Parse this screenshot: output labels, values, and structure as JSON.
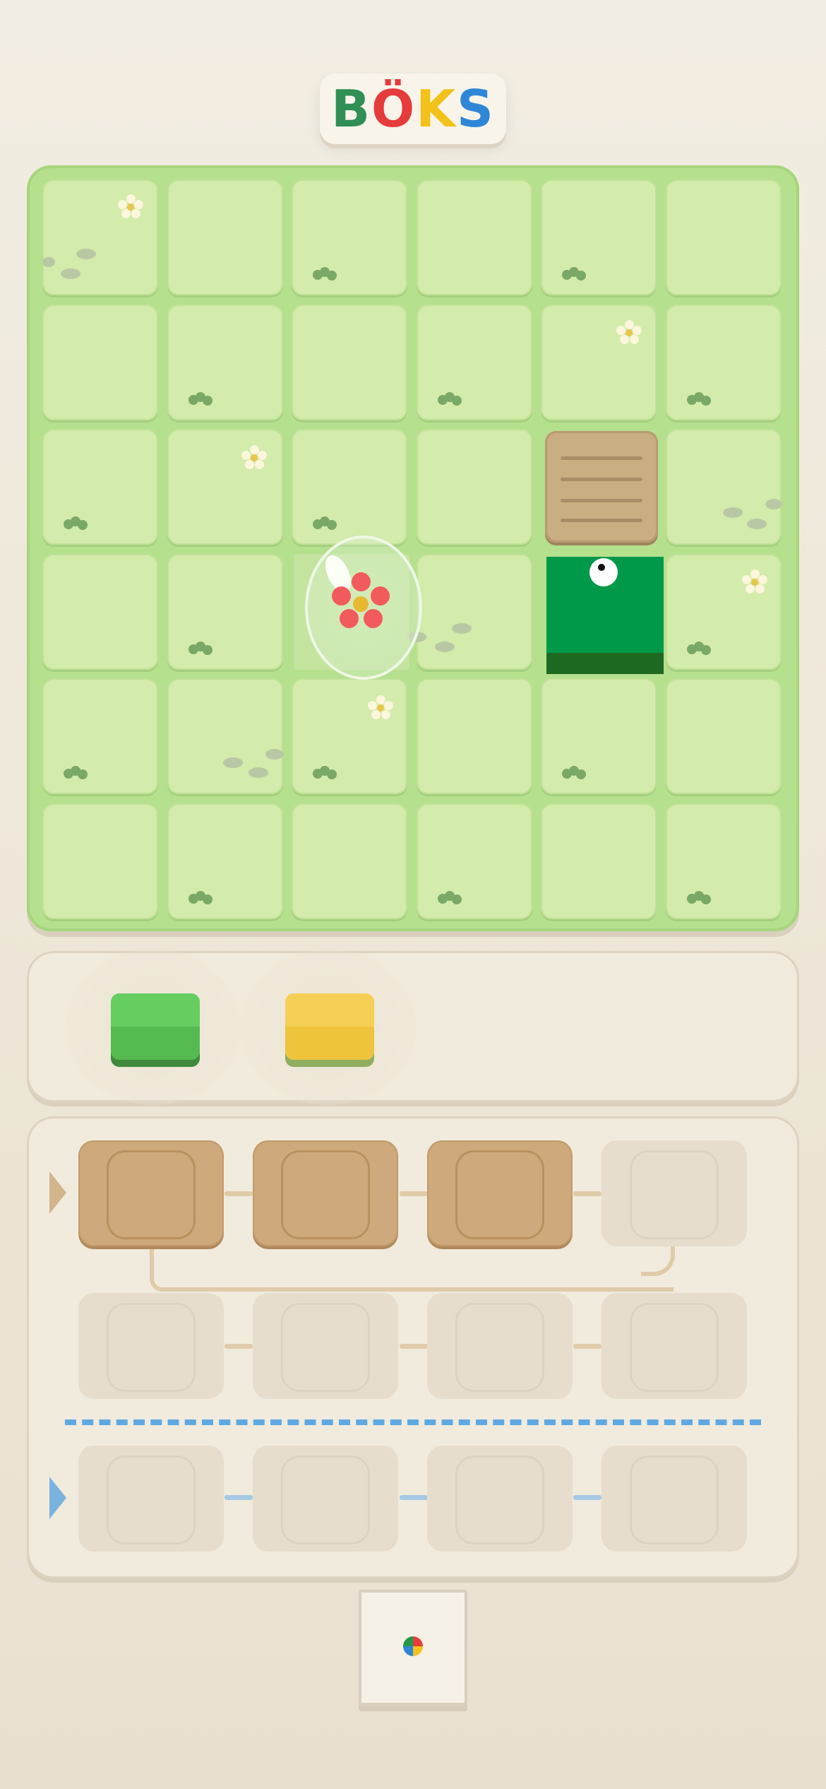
{
  "title": {
    "letters": [
      "B",
      "Ö",
      "K",
      "S"
    ],
    "colors": [
      "#2f8f55",
      "#e63b3b",
      "#f2c11a",
      "#2f86d6"
    ]
  },
  "board": {
    "rows": 6,
    "cols": 6,
    "player": {
      "row": 3,
      "col": 4,
      "color": "#00994a"
    },
    "goal": {
      "row": 3,
      "col": 2,
      "icon": "flower-goal-icon"
    },
    "crate": {
      "row": 2,
      "col": 4
    }
  },
  "palette": {
    "blocks": [
      {
        "name": "green-block",
        "color": "#5cc257"
      },
      {
        "name": "yellow-block",
        "color": "#f2c84b"
      }
    ]
  },
  "program": {
    "rows": [
      {
        "slots": [
          "filled",
          "filled",
          "filled",
          "empty"
        ]
      },
      {
        "slots": [
          "empty",
          "empty",
          "empty",
          "empty"
        ]
      },
      {
        "slots": [
          "empty",
          "empty",
          "empty",
          "empty"
        ]
      }
    ],
    "accent_blue": "#5fa9e3"
  },
  "run_button": {
    "icon": "color-wheel-icon"
  }
}
